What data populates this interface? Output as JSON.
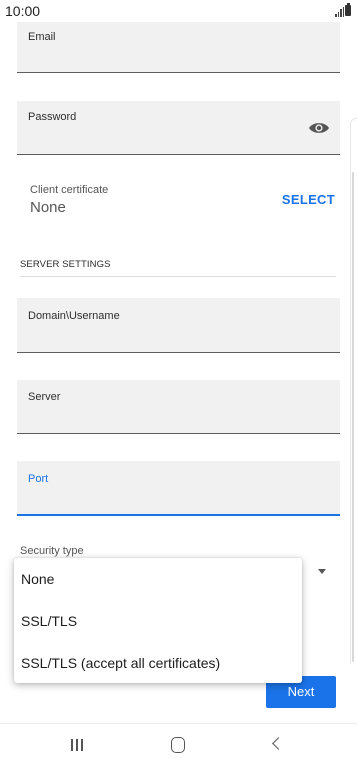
{
  "status_bar": {
    "time": "10:00"
  },
  "fields": {
    "email": {
      "label": "Email",
      "value": ""
    },
    "password": {
      "label": "Password",
      "value": "",
      "icon": "eye-icon"
    },
    "domain_username": {
      "label": "Domain\\Username",
      "value": ""
    },
    "server": {
      "label": "Server",
      "value": ""
    },
    "port": {
      "label": "Port",
      "value": ""
    }
  },
  "client_certificate": {
    "label": "Client certificate",
    "value": "None",
    "action": "SELECT"
  },
  "server_settings": {
    "title": "SERVER SETTINGS"
  },
  "security_type": {
    "label": "Security type",
    "options": [
      "None",
      "SSL/TLS",
      "SSL/TLS (accept all certificates)"
    ]
  },
  "next_button": {
    "label": "Next"
  },
  "colors": {
    "accent": "#1a73e8",
    "field_background": "#f1f1f1"
  }
}
